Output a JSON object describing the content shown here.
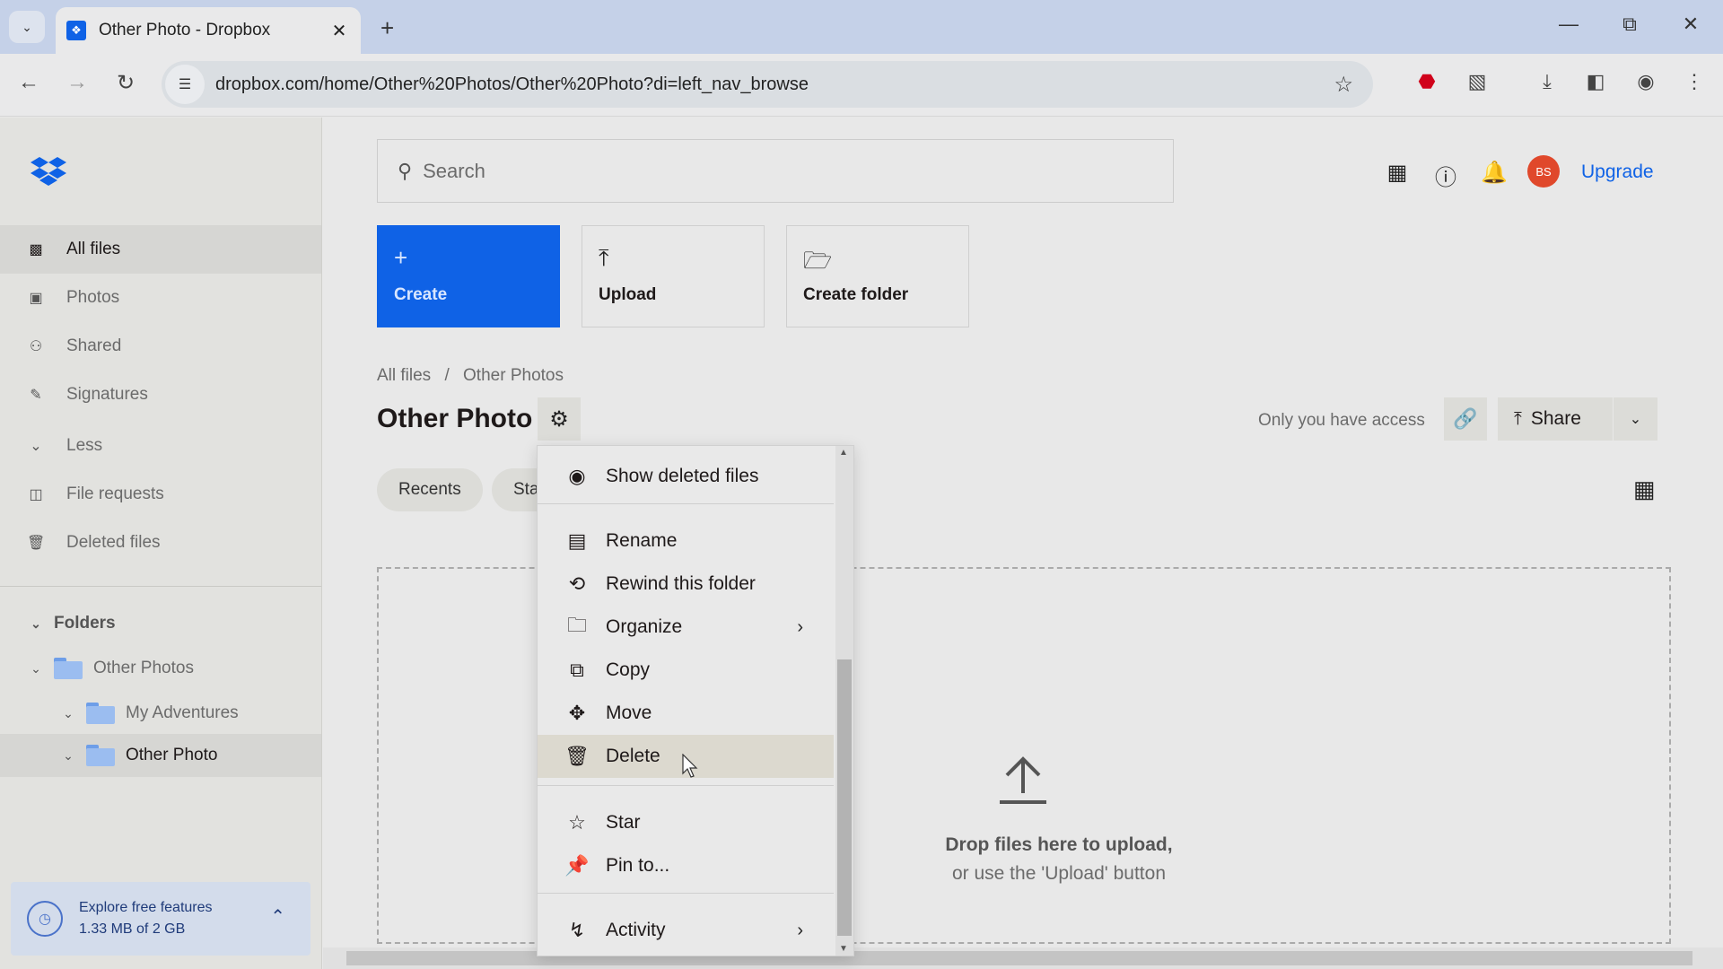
{
  "browser": {
    "tab_title": "Other Photo - Dropbox",
    "url": "dropbox.com/home/Other%20Photos/Other%20Photo?di=left_nav_browse",
    "icons": {
      "tab_list": "chevron-down-icon",
      "close_tab": "close-icon",
      "new_tab": "plus-icon",
      "back": "arrow-left-icon",
      "forward": "arrow-right-icon",
      "reload": "reload-icon",
      "site_settings": "tune-icon",
      "bookmark": "star-icon",
      "extension_adblock": "stop-icon",
      "extensions": "puzzle-icon",
      "downloads": "download-icon",
      "side_panel": "side-panel-icon",
      "profile": "profile-avatar-icon",
      "menu": "kebab-menu-icon"
    }
  },
  "sidebar": {
    "items": [
      {
        "label": "All files",
        "icon": "all-files-icon",
        "active": true
      },
      {
        "label": "Photos",
        "icon": "photos-icon",
        "active": false
      },
      {
        "label": "Shared",
        "icon": "shared-icon",
        "active": false
      },
      {
        "label": "Signatures",
        "icon": "signature-icon",
        "active": false
      },
      {
        "label": "Less",
        "icon": "chevron-down-icon",
        "active": false
      },
      {
        "label": "File requests",
        "icon": "file-request-icon",
        "active": false
      },
      {
        "label": "Deleted files",
        "icon": "trash-icon",
        "active": false
      }
    ],
    "folders_label": "Folders",
    "folders": [
      {
        "label": "Other Photos",
        "level": 0,
        "active": false
      },
      {
        "label": "My Adventures",
        "level": 1,
        "active": false
      },
      {
        "label": "Other Photo",
        "level": 1,
        "active": true
      }
    ],
    "explore": {
      "title": "Explore free features",
      "usage": "1.33 MB of 2 GB"
    }
  },
  "header": {
    "search_placeholder": "Search",
    "avatar_initials": "BS",
    "upgrade_label": "Upgrade"
  },
  "actions": [
    {
      "label": "Create",
      "icon": "plus-icon"
    },
    {
      "label": "Upload",
      "icon": "upload-icon"
    },
    {
      "label": "Create folder",
      "icon": "create-folder-icon"
    }
  ],
  "breadcrumb": [
    "All files",
    "/",
    "Other Photos"
  ],
  "page_title": "Other Photo",
  "access_text": "Only you have access",
  "share_label": "Share",
  "filter_chips": [
    "Recents",
    "Starred"
  ],
  "dropzone": {
    "line1": "Drop files here to upload,",
    "line2": "or use the 'Upload' button"
  },
  "context_menu": {
    "items": [
      {
        "label": "Show deleted files",
        "icon": "eye-icon",
        "submenu": false,
        "highlighted": false
      },
      {
        "label": "Rename",
        "icon": "rename-icon",
        "submenu": false,
        "highlighted": false
      },
      {
        "label": "Rewind this folder",
        "icon": "rewind-icon",
        "submenu": false,
        "highlighted": false
      },
      {
        "label": "Organize",
        "icon": "organize-folder-icon",
        "submenu": true,
        "highlighted": false
      },
      {
        "label": "Copy",
        "icon": "copy-icon",
        "submenu": false,
        "highlighted": false
      },
      {
        "label": "Move",
        "icon": "move-icon",
        "submenu": false,
        "highlighted": false
      },
      {
        "label": "Delete",
        "icon": "trash-icon",
        "submenu": false,
        "highlighted": true
      },
      {
        "label": "Star",
        "icon": "star-icon",
        "submenu": false,
        "highlighted": false
      },
      {
        "label": "Pin to...",
        "icon": "pin-icon",
        "submenu": false,
        "highlighted": false
      },
      {
        "label": "Activity",
        "icon": "activity-icon",
        "submenu": true,
        "highlighted": false
      }
    ]
  },
  "colors": {
    "brand_blue": "#0f62e6",
    "avatar_red": "#e0482b",
    "menu_highlight": "#dcd9cf"
  }
}
